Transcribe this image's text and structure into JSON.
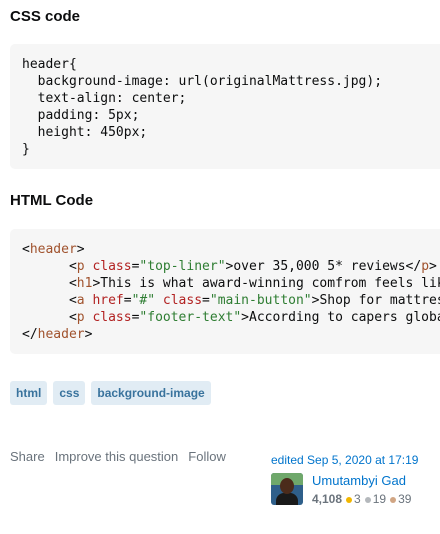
{
  "css_heading": "CSS code",
  "css_code": [
    "header{",
    "  background-image: url(originalMattress.jpg);",
    "  text-align: center;",
    "  padding: 5px;",
    "  height: 450px;",
    "}"
  ],
  "html_heading": "HTML Code",
  "html_code": {
    "open_tag": "header",
    "p1_class": "top-liner",
    "p1_text": "over 35,000 5* reviews",
    "h1_text": "This is what award-winning comfrom feels like",
    "a_href": "#",
    "a_class": "main-button",
    "a_text": "Shop for mattresses",
    "p2_class": "footer-text",
    "p2_text": "According to capers global"
  },
  "tags": [
    "html",
    "css",
    "background-image"
  ],
  "actions": {
    "share": "Share",
    "improve": "Improve this question",
    "follow": "Follow"
  },
  "edited": "edited Sep 5, 2020 at 17:19",
  "user": {
    "name": "Umutambyi Gad",
    "reputation": "4,108",
    "gold": "3",
    "silver": "19",
    "bronze": "39"
  }
}
